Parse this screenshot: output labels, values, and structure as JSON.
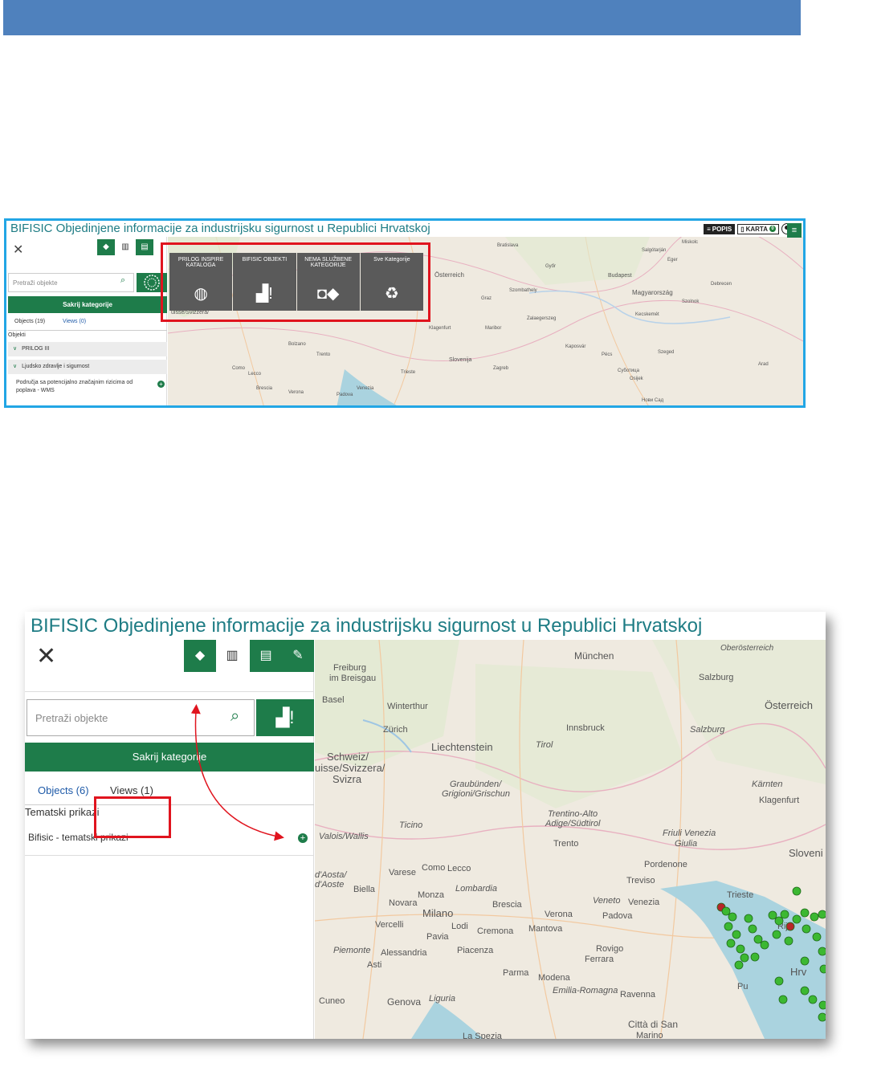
{
  "shot1": {
    "app_title": "BIFISIC Objedinjene informacije za industrijsku sigurnost u Republici Hrvatskoj",
    "header": {
      "popis_label": "POPIS",
      "karta_label": "KARTA",
      "karta_badge": "0"
    },
    "search_placeholder": "Pretraži objekte",
    "hide_categories": "Sakrij kategorije",
    "tabs": {
      "objects": "Objects (19)",
      "views": "Views (0)"
    },
    "section_label": "Objekti",
    "tree": [
      {
        "label": "PRILOG III"
      },
      {
        "label": "Ljudsko zdravlje i sigurnost"
      }
    ],
    "item_label": "Područja sa potencijalno značajnim rizicima od poplava - WMS",
    "categories": [
      {
        "label": "PRILOG INSPIRE KATALOGA",
        "icon": "globe-icon"
      },
      {
        "label": "BIFISIC OBJEKTI",
        "icon": "factory-alert-icon"
      },
      {
        "label": "NEMA SLUŽBENE KATEGORIJE",
        "icon": "shapes-icon"
      },
      {
        "label": "Sve Kategorije",
        "icon": "recycle-icon"
      }
    ],
    "map_labels": {
      "bratislava": "Bratislava",
      "miskolc": "Miskolc",
      "osterreich": "Österreich",
      "budapest": "Budapest",
      "magyarorszag": "Magyarország",
      "svizzera": "uisse/Svizzera/",
      "slovenija": "Slovenija",
      "zagreb": "Zagreb",
      "graz": "Graz",
      "maribor": "Maribor",
      "szeged": "Szeged",
      "venezia": "Venezia",
      "trento": "Trento",
      "novi_sad": "Нови Сад",
      "debrecen": "Debrecen",
      "szolnok": "Szolnok",
      "kecskemet": "Kecskemét",
      "pecs": "Pécs",
      "eger": "Eger",
      "salgotarjan": "Salgótarján",
      "gyor": "Győr",
      "kaposvar": "Kaposvár",
      "osijek": "Osijek",
      "subotica": "Суботица",
      "arad": "Arad",
      "zalaegerszeg": "Zalaegerszeg",
      "szombathely": "Szombathely",
      "klagenfurt": "Klagenfurt",
      "trieste": "Trieste",
      "padova": "Padova",
      "verona": "Verona",
      "bolzano": "Bolzano",
      "brescia": "Brescia",
      "lecco": "Lecco",
      "como": "Como"
    }
  },
  "shot2": {
    "app_title": "BIFISIC Objedinjene informacije za industrijsku sigurnost u Republici Hrvatskoj",
    "search_placeholder": "Pretraži objekte",
    "hide_categories": "Sakrij kategorije",
    "tabs": {
      "objects": "Objects (6)",
      "views": "Views (1)"
    },
    "section_label": "Tematski prikazi",
    "view_item": "Bifisic - tematski prikazi",
    "map_labels": {
      "freiburg": "Freiburg",
      "breisgau": "im Breisgau",
      "munchen": "München",
      "salzburg": "Salzburg",
      "oberosterreich": "Oberösterreich",
      "basel": "Basel",
      "winterthur": "Winterthur",
      "zurich": "Zürich",
      "osterreich": "Österreich",
      "innsbruck": "Innsbruck",
      "salzburg_region": "Salzburg",
      "liechtenstein": "Liechtenstein",
      "tirol": "Tirol",
      "schweiz1": "Schweiz/",
      "schweiz2": "uisse/Svizzera/",
      "schweiz3": "Svizra",
      "graubunden1": "Graubünden/",
      "graubunden2": "Grigioni/Grischun",
      "karnten": "Kärnten",
      "klagenfurt": "Klagenfurt",
      "ticino": "Ticino",
      "trentino1": "Trentino-Alto",
      "trentino2": "Adige/Südtirol",
      "valois": "Valois/Wallis",
      "friuli1": "Friuli Venezia",
      "friuli2": "Giulia",
      "trento": "Trento",
      "aosta1": "d'Aosta/",
      "aosta2": "d'Aoste",
      "slovenija": "Sloveni",
      "como": "Como",
      "lecco": "Lecco",
      "pordenone": "Pordenone",
      "varese": "Varese",
      "treviso": "Treviso",
      "biella": "Biella",
      "monza": "Monza",
      "lombardia": "Lombardia",
      "veneto": "Veneto",
      "venezia": "Venezia",
      "trieste": "Trieste",
      "novara": "Novara",
      "milano": "Milano",
      "brescia": "Brescia",
      "verona": "Verona",
      "padova": "Padova",
      "rijeka": "Rij",
      "vercelli": "Vercelli",
      "lodi": "Lodi",
      "cremona": "Cremona",
      "mantova": "Mantova",
      "pavia": "Pavia",
      "rovigo": "Rovigo",
      "piemonte": "Piemonte",
      "alessandria": "Alessandria",
      "piacenza": "Piacenza",
      "ferrara": "Ferrara",
      "asti": "Asti",
      "parma": "Parma",
      "modena": "Modena",
      "hrv": "Hrv",
      "pula": "Pu",
      "emilia": "Emilia-Romagna",
      "cuneo": "Cuneo",
      "genova": "Genova",
      "liguria": "Liguria",
      "ravenna": "Ravenna",
      "citta_di_san": "Città di San",
      "marino": "Marino",
      "la_spezia": "La Spezia"
    }
  },
  "colors": {
    "brand_green": "#1e7c4a",
    "title_teal": "#1e7c84",
    "highlight_red": "#e0141e",
    "frame_blue": "#22a6e5",
    "doc_band": "#4f81bd",
    "marker_green": "#3cb832"
  }
}
